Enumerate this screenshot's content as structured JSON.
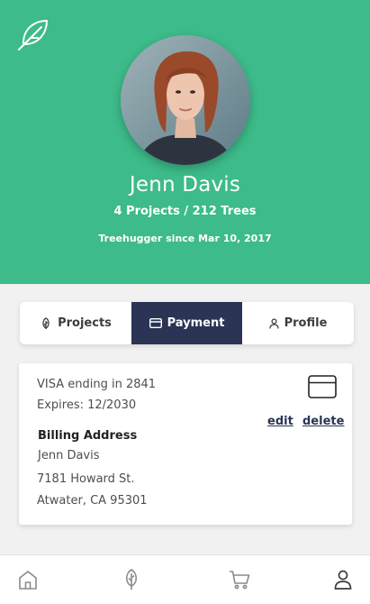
{
  "profile": {
    "name": "Jenn Davis",
    "stats": "4 Projects / 212 Trees",
    "since": "Treehugger since Mar 10, 2017"
  },
  "tabs": [
    {
      "label": "Projects",
      "icon": "leaf-icon"
    },
    {
      "label": "Payment",
      "icon": "credit-card-icon",
      "active": true
    },
    {
      "label": "Profile",
      "icon": "person-icon"
    }
  ],
  "payment": {
    "card_line": "VISA ending in 2841",
    "expires": "Expires: 12/2030",
    "billing_heading": "Billing Address",
    "billing_name": "Jenn Davis",
    "street": "7181 Howard St.",
    "city": "Atwater, CA 95301",
    "edit_label": "edit",
    "delete_label": "delete"
  },
  "nav": [
    {
      "icon": "home-icon"
    },
    {
      "icon": "leaf-icon"
    },
    {
      "icon": "cart-icon"
    },
    {
      "icon": "person-icon"
    }
  ],
  "colors": {
    "brand_green": "#3dbb8a",
    "active_tab": "#2b3455"
  }
}
